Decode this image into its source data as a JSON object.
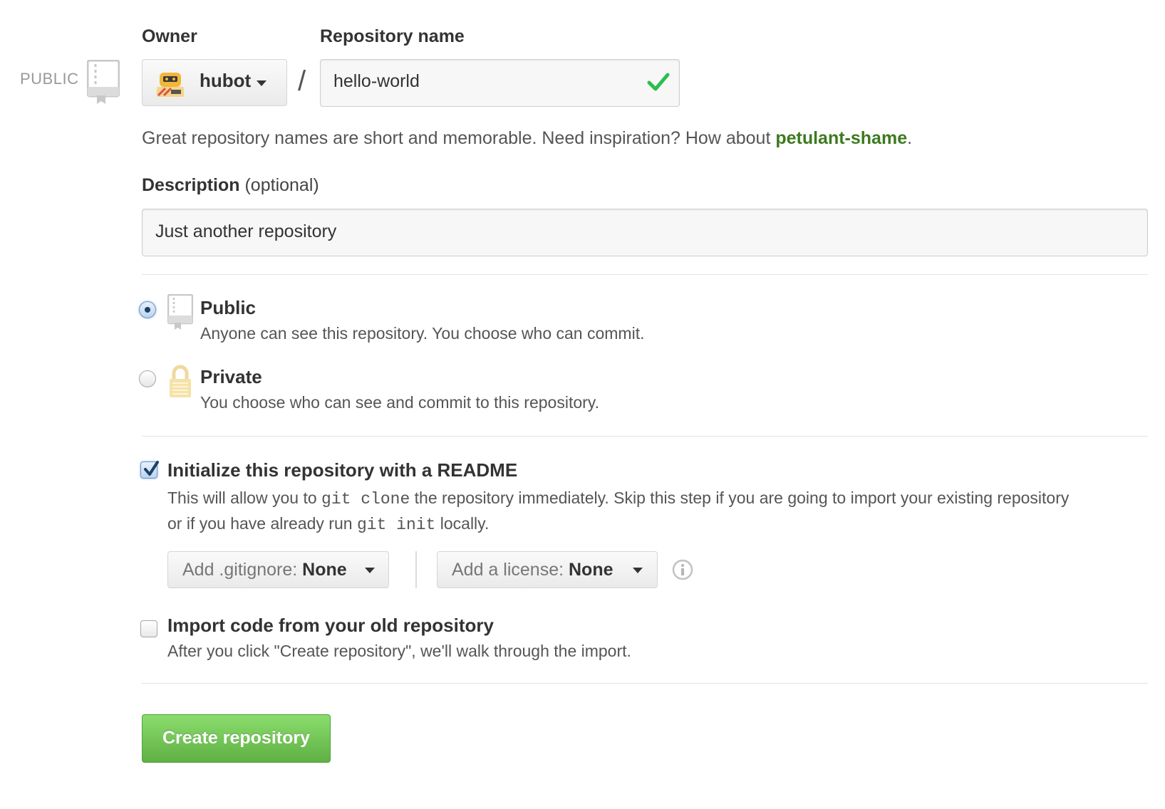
{
  "owner": {
    "label": "Owner",
    "selected": "hubot",
    "avatar_icon": "hubot-avatar"
  },
  "repo_name": {
    "label": "Repository name",
    "value": "hello-world",
    "separator": "/",
    "status_icon": "valid-check-icon"
  },
  "visibility_badge": "PUBLIC",
  "hint": {
    "text": "Great repository names are short and memorable. Need inspiration? How about ",
    "suggestion": "petulant-shame",
    "suffix": "."
  },
  "description": {
    "label": "Description",
    "optional": "(optional)",
    "value": "Just another repository"
  },
  "visibility": {
    "selected": "public",
    "options": [
      {
        "title": "Public",
        "desc": "Anyone can see this repository. You choose who can commit."
      },
      {
        "title": "Private",
        "desc": "You choose who can see and commit to this repository."
      }
    ]
  },
  "readme": {
    "checked": true,
    "title": "Initialize this repository with a README",
    "desc_1": "This will allow you to ",
    "code_1": "git clone",
    "desc_2": " the repository immediately. Skip this step if you are going to import your existing repository",
    "desc_3": "or if you have already run ",
    "code_2": "git init",
    "desc_4": " locally."
  },
  "gitignore": {
    "prefix": "Add .gitignore: ",
    "value": "None"
  },
  "license": {
    "prefix": "Add a license: ",
    "value": "None"
  },
  "import": {
    "checked": false,
    "title": "Import code from your old repository",
    "desc": "After you click \"Create repository\", we'll walk through the import."
  },
  "submit": {
    "label": "Create repository"
  },
  "colors": {
    "suggestion": "#3c7a1f",
    "button_green": "#60b044",
    "check_green": "#2cbe4e"
  }
}
